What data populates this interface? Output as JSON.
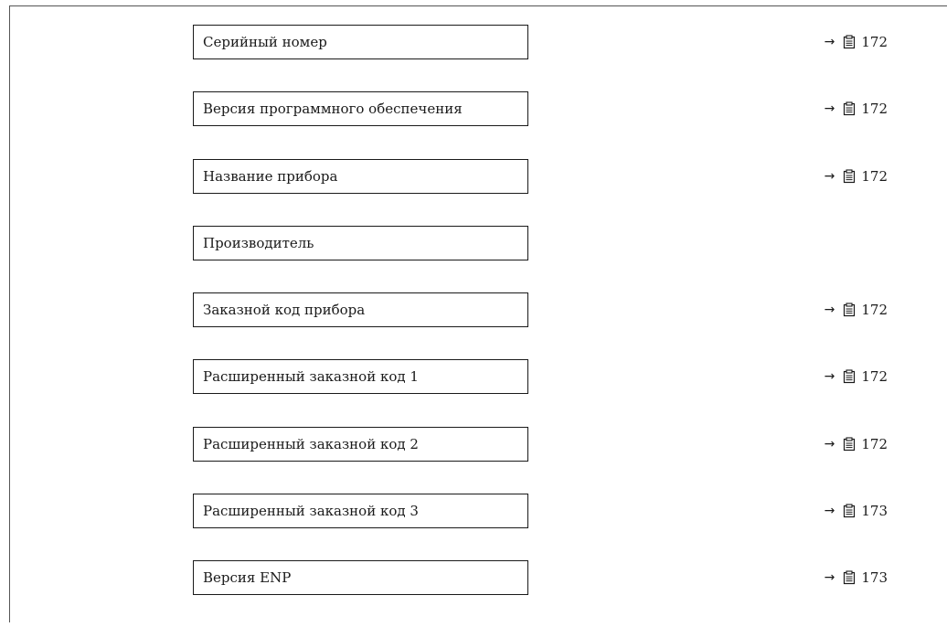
{
  "arrow_glyph": "→",
  "icon": "page-reference-icon",
  "rows": [
    {
      "label": "Серийный номер",
      "page": "172"
    },
    {
      "label": "Версия программного обеспечения",
      "page": "172"
    },
    {
      "label": "Название прибора",
      "page": "172"
    },
    {
      "label": "Производитель",
      "page": ""
    },
    {
      "label": "Заказной код прибора",
      "page": "172"
    },
    {
      "label": "Расширенный заказной код 1",
      "page": "172"
    },
    {
      "label": "Расширенный заказной код 2",
      "page": "172"
    },
    {
      "label": "Расширенный заказной код 3",
      "page": "173"
    },
    {
      "label": "Версия ENP",
      "page": "173"
    }
  ]
}
